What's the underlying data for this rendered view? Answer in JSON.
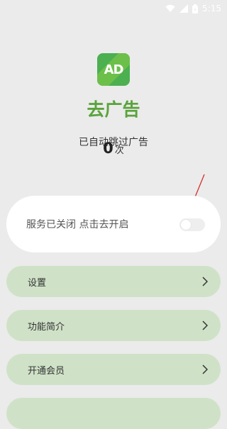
{
  "status_bar": {
    "time": "5:15"
  },
  "logo": {
    "text": "AD"
  },
  "app": {
    "title": "去广告",
    "skip_label": "已自动跳过广告",
    "skip_count": "0",
    "skip_unit": "次"
  },
  "service": {
    "status_text": "服务已关闭 点击去开启",
    "enabled": false
  },
  "menu": [
    {
      "label": "设置"
    },
    {
      "label": "功能简介"
    },
    {
      "label": "开通会员"
    }
  ],
  "colors": {
    "accent": "#5aa33c",
    "logo_bg": "#4caf50",
    "menu_bg": "#cfe2c7",
    "background": "#ebebeb",
    "annotation": "#d32f2f"
  }
}
